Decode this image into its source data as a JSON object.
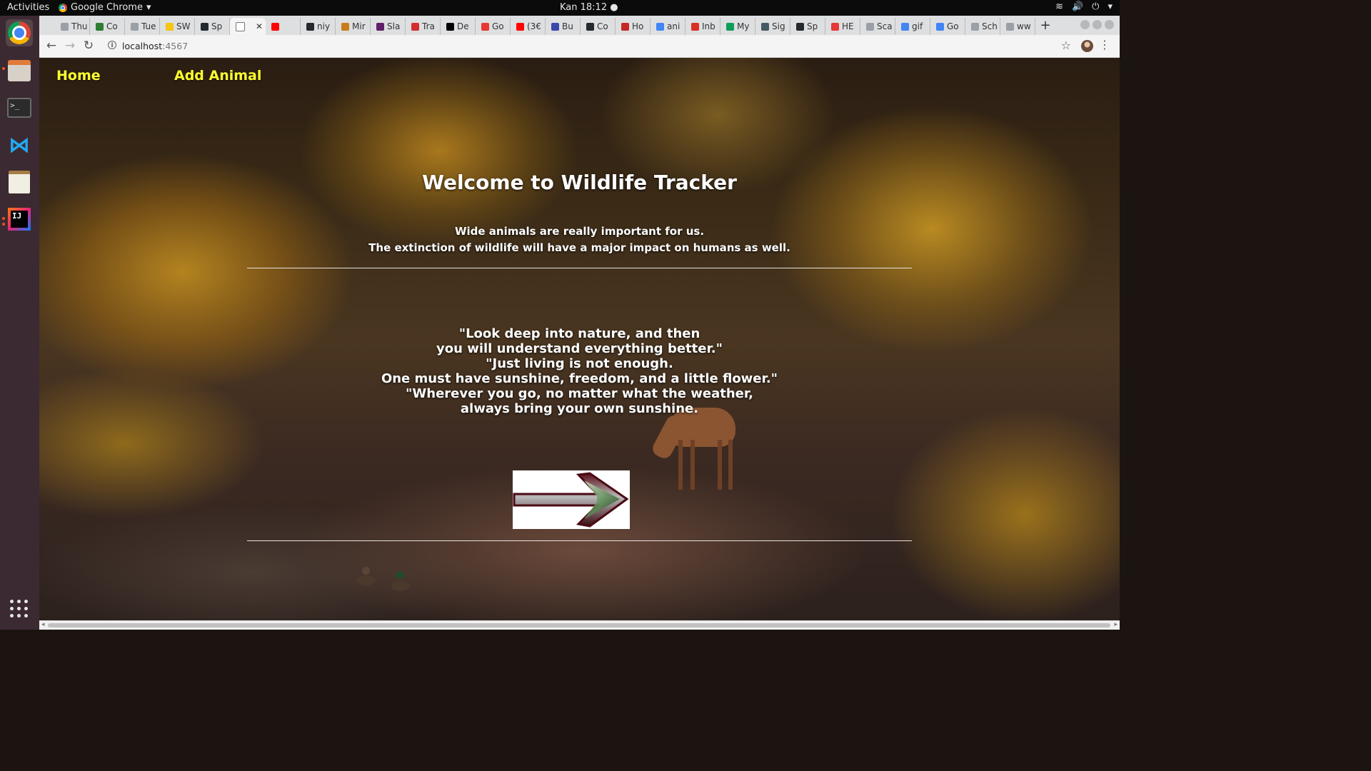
{
  "os": {
    "activities_label": "Activities",
    "app_name": "Google Chrome",
    "clock": "Kan 18:12 ●"
  },
  "tabs": [
    {
      "label": "Thu",
      "favicon_color": "#9aa0a6"
    },
    {
      "label": "Co",
      "favicon_color": "#2e7d32"
    },
    {
      "label": "Tue",
      "favicon_color": "#9aa0a6"
    },
    {
      "label": "SW",
      "favicon_color": "#f5c518"
    },
    {
      "label": "Sp",
      "favicon_color": "#24292e"
    },
    {
      "label": "",
      "favicon_color": "#ffffff",
      "active": true
    },
    {
      "label": "",
      "favicon_color": "#ff0000"
    },
    {
      "label": "niy",
      "favicon_color": "#24292e"
    },
    {
      "label": "Mir",
      "favicon_color": "#c97d1a"
    },
    {
      "label": "Sla",
      "favicon_color": "#611f69"
    },
    {
      "label": "Tra",
      "favicon_color": "#d32f2f"
    },
    {
      "label": "De",
      "favicon_color": "#000000"
    },
    {
      "label": "Go",
      "favicon_color": "#e53935"
    },
    {
      "label": "(3€",
      "favicon_color": "#ff0000"
    },
    {
      "label": "Bu",
      "favicon_color": "#3949ab"
    },
    {
      "label": "Co",
      "favicon_color": "#24292e"
    },
    {
      "label": "Ho",
      "favicon_color": "#c62828"
    },
    {
      "label": "ani",
      "favicon_color": "#4285f4"
    },
    {
      "label": "Inb",
      "favicon_color": "#d93025"
    },
    {
      "label": "My",
      "favicon_color": "#0f9d58"
    },
    {
      "label": "Sig",
      "favicon_color": "#455a64"
    },
    {
      "label": "Sp",
      "favicon_color": "#24292e"
    },
    {
      "label": "HE",
      "favicon_color": "#e53935"
    },
    {
      "label": "Sca",
      "favicon_color": "#9aa0a6"
    },
    {
      "label": "gif",
      "favicon_color": "#4285f4"
    },
    {
      "label": "Go",
      "favicon_color": "#4285f4"
    },
    {
      "label": "Sch",
      "favicon_color": "#9aa0a6"
    },
    {
      "label": "ww",
      "favicon_color": "#9aa0a6"
    }
  ],
  "toolbar": {
    "url_host": "localhost",
    "url_port": ":4567"
  },
  "page": {
    "nav": {
      "home": "Home",
      "add_animal": "Add Animal"
    },
    "heading": "Welcome to Wildlife Tracker",
    "subtext": [
      "Wide animals are really important for us.",
      "The extinction of wildlife will have a major impact on humans as well."
    ],
    "quotes": [
      "\"Look deep into nature, and then",
      "you will understand everything better.\"",
      "\"Just living is not enough.",
      "One must have sunshine, freedom, and a little flower.\"",
      "\"Wherever you go, no matter what the weather,",
      "always bring your own sunshine."
    ],
    "arrow_icon": "right-arrow-icon"
  },
  "colors": {
    "nav_link": "#ffff2e",
    "page_text": "#ffffff",
    "arrow_fill": "#7a1020"
  }
}
